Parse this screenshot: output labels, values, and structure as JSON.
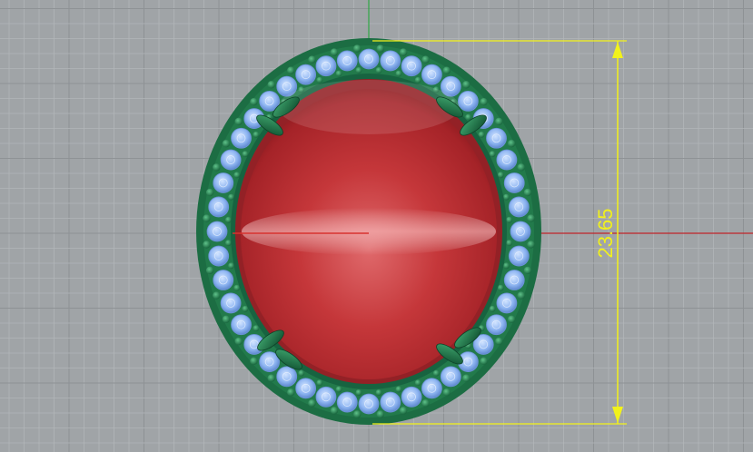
{
  "viewport": {
    "background_color": "#a0a4a7",
    "grid_minor_color": "#b2b6b9",
    "grid_major_color": "#8e9295",
    "x_axis_color": "#c0242a",
    "y_axis_color": "#2fa845"
  },
  "model": {
    "gem_color": "#c5373a",
    "gem_highlight_color": "#ec8a8a",
    "setting_color": "#1f7a4a",
    "accent_stone_color": "#8fb6f2",
    "prong_color": "#1d6b44"
  },
  "dimension": {
    "value": "23.65",
    "line_color": "#f2f21a",
    "icon": "vertical-dimension-icon"
  }
}
